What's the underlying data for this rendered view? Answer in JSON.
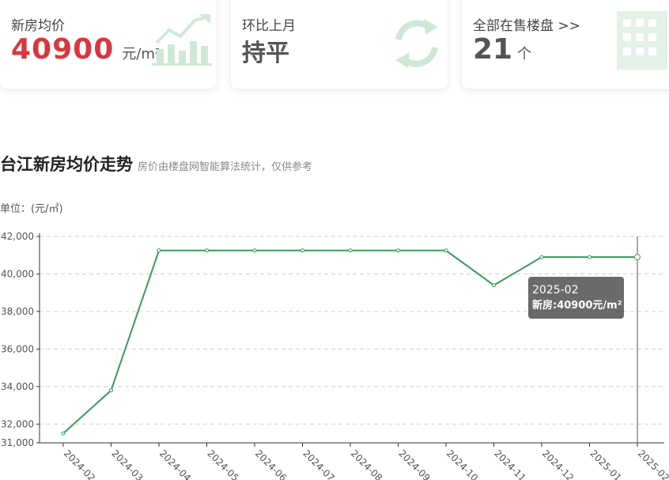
{
  "cards": [
    {
      "label": "新房均价",
      "value": "40900",
      "unit": "元/m²",
      "icon": "trend-chart-icon"
    },
    {
      "label": "环比上月",
      "value": "持平",
      "icon": "refresh-cycle-icon"
    },
    {
      "label": "全部在售楼盘 >>",
      "value": "21",
      "unit": "个",
      "icon": "building-icon"
    }
  ],
  "section": {
    "title": "台江新房均价走势",
    "subtitle": "房价由楼盘网智能算法统计，仅供参考",
    "unit_label": "单位：(元/㎡)"
  },
  "tooltip": {
    "title": "2025-02",
    "body": "新房:40900元/m²"
  },
  "colors": {
    "accent_red": "#d9363e",
    "line": "#3a9a5c",
    "icon_green": "#cfe8d6"
  },
  "chart_data": {
    "type": "line",
    "categories": [
      "2024-02",
      "2024-03",
      "2024-04",
      "2024-05",
      "2024-06",
      "2024-07",
      "2024-08",
      "2024-09",
      "2024-10",
      "2024-11",
      "2024-12",
      "2025-01",
      "2025-02"
    ],
    "series": [
      {
        "name": "新房",
        "values": [
          31500,
          33800,
          41250,
          41250,
          41250,
          41250,
          41250,
          41250,
          41250,
          39400,
          40900,
          40900,
          40900
        ]
      }
    ],
    "ylim": [
      31000,
      42000
    ],
    "yticks": [
      31000,
      32000,
      34000,
      36000,
      38000,
      40000,
      42000
    ],
    "ytick_labels": [
      "31,000",
      "32,000",
      "34,000",
      "36,000",
      "38,000",
      "40,000",
      "42,000"
    ],
    "grid": true,
    "highlight": "2025-02"
  }
}
